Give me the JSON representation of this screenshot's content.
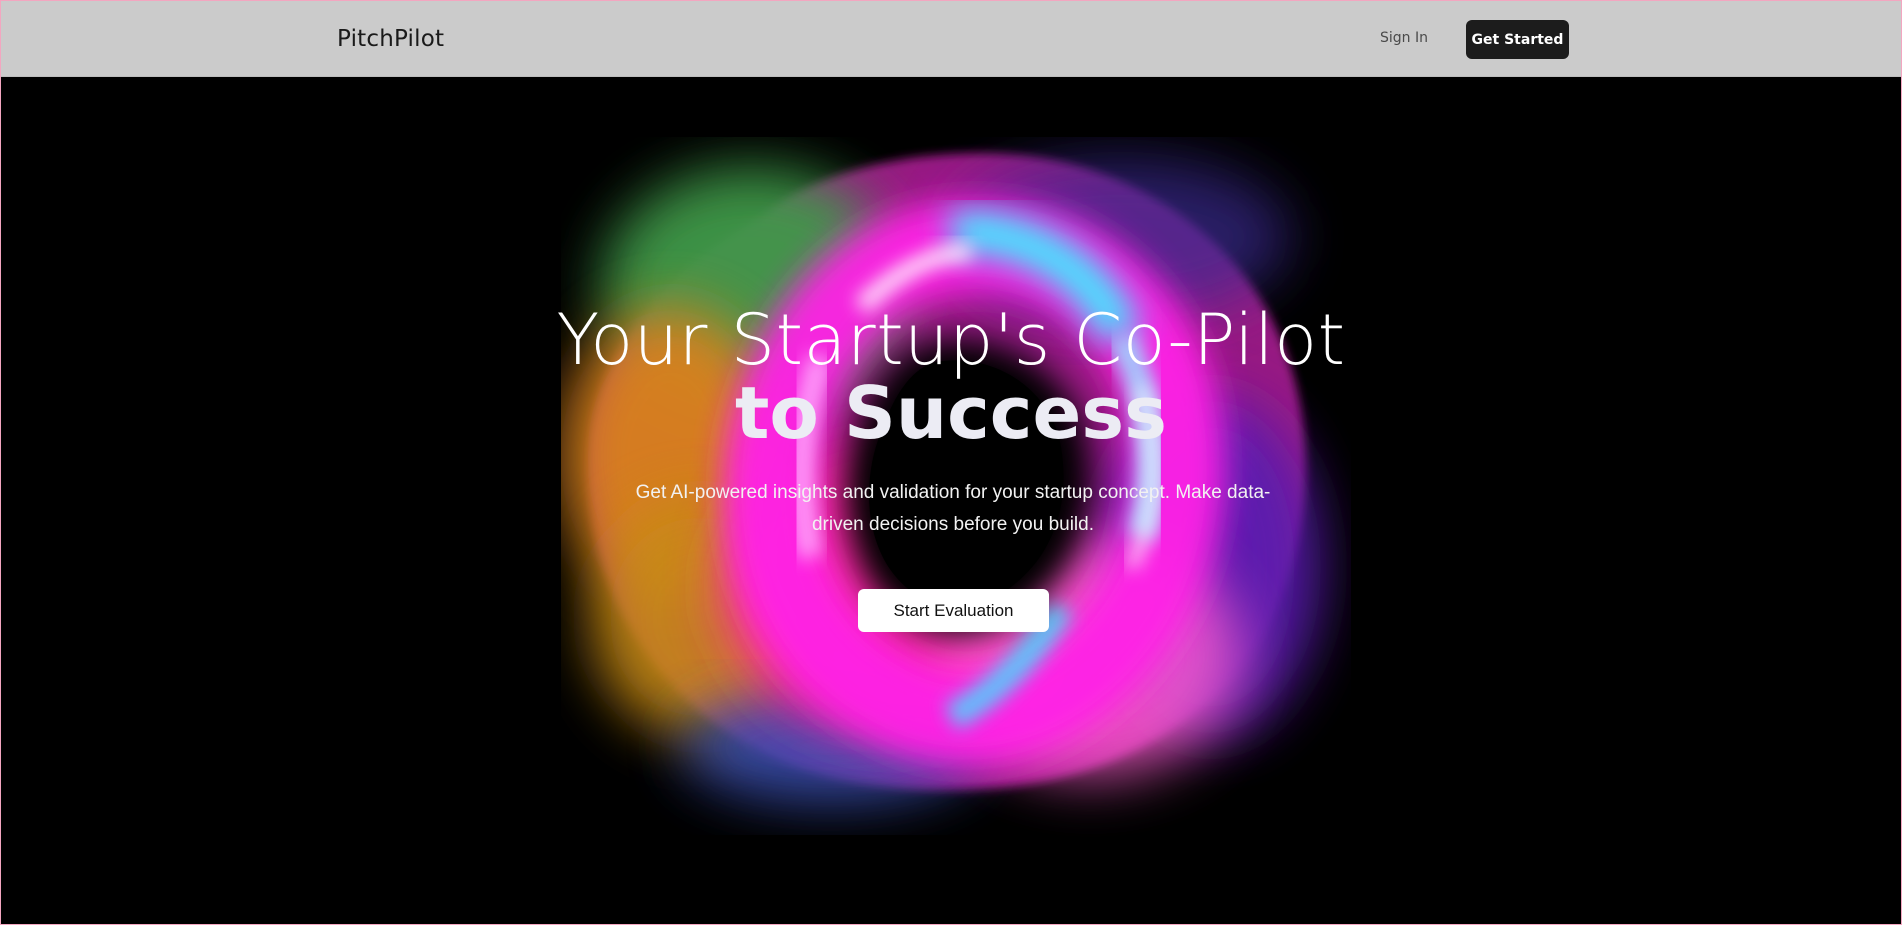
{
  "header": {
    "brand": "PitchPilot",
    "sign_in_label": "Sign In",
    "get_started_label": "Get Started"
  },
  "hero": {
    "title_line1": "Your Startup's Co-Pilot",
    "title_line2": "to Success",
    "subtitle": "Get AI-powered insights and validation for your startup concept. Make data-driven decisions before you build.",
    "cta_label": "Start Evaluation"
  },
  "colors": {
    "header_bg": "#cbcbcb",
    "hero_bg": "#000000",
    "button_dark": "#1c1c1c",
    "button_light": "#ffffff",
    "orb_magenta": "#ff1ad9",
    "orb_cyan": "#3de6ff",
    "orb_green": "#3f9a4a",
    "orb_orange": "#d9821f",
    "orb_purple": "#6b2bd6"
  }
}
